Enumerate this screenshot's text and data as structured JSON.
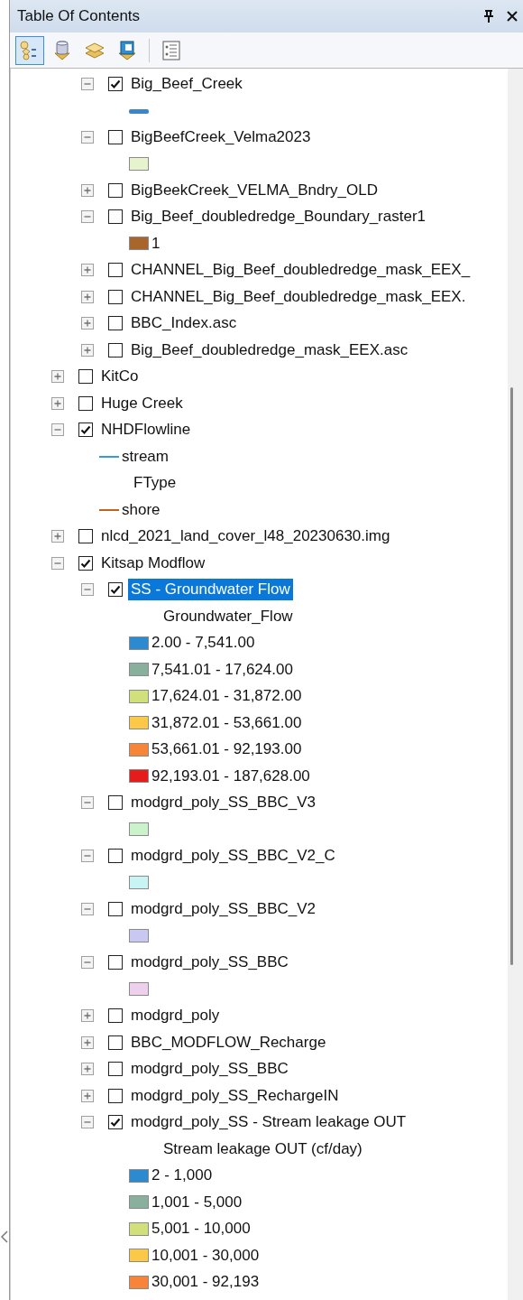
{
  "panel": {
    "title": "Table Of Contents"
  },
  "toolbar": [
    {
      "kind": "drawing-order",
      "selected": true
    },
    {
      "kind": "source",
      "selected": false
    },
    {
      "kind": "visibility",
      "selected": false
    },
    {
      "kind": "selection",
      "selected": false
    },
    {
      "kind": "options",
      "selected": false
    }
  ],
  "tree": [
    {
      "kind": "continuation",
      "children": [
        {
          "kind": "layer",
          "name": "Big_Beef_Creek",
          "checked": true,
          "expanded": true,
          "selected": false,
          "children": [
            {
              "kind": "legend-line",
              "color": "#3a86c8"
            }
          ]
        },
        {
          "kind": "layer",
          "name": "BigBeefCreek_Velma2023",
          "checked": false,
          "expanded": true,
          "selected": false,
          "children": [
            {
              "kind": "legend-fill",
              "color": "#e6f3cc"
            }
          ]
        },
        {
          "kind": "layer",
          "name": "BigBeekCreek_VELMA_Bndry_OLD",
          "checked": false,
          "expanded": false,
          "selected": false
        },
        {
          "kind": "layer",
          "name": "Big_Beef_doubledredge_Boundary_raster1",
          "checked": false,
          "expanded": true,
          "selected": false,
          "children": [
            {
              "kind": "legend-fill",
              "color": "#a8652c",
              "label": "1"
            }
          ]
        },
        {
          "kind": "layer",
          "name": "CHANNEL_Big_Beef_doubledredge_mask_EEX_",
          "checked": false,
          "expanded": false,
          "selected": false
        },
        {
          "kind": "layer",
          "name": "CHANNEL_Big_Beef_doubledredge_mask_EEX.",
          "checked": false,
          "expanded": false,
          "selected": false
        },
        {
          "kind": "layer",
          "name": "BBC_Index.asc",
          "checked": false,
          "expanded": false,
          "selected": false
        },
        {
          "kind": "layer",
          "name": "Big_Beef_doubledredge_mask_EEX.asc",
          "checked": false,
          "expanded": false,
          "selected": false
        }
      ]
    },
    {
      "kind": "layer",
      "name": "KitCo",
      "checked": false,
      "expanded": false,
      "selected": false
    },
    {
      "kind": "layer",
      "name": "Huge Creek",
      "checked": false,
      "expanded": false,
      "selected": false
    },
    {
      "kind": "layer",
      "name": "NHDFlowline",
      "checked": true,
      "expanded": true,
      "selected": false,
      "children": [
        {
          "kind": "legend-thin-line",
          "color": "#3a9ad8",
          "label": "stream"
        },
        {
          "kind": "heading",
          "label": "FType"
        },
        {
          "kind": "legend-thin-line",
          "color": "#c0641c",
          "label": "shore"
        }
      ]
    },
    {
      "kind": "layer",
      "name": "nlcd_2021_land_cover_l48_20230630.img",
      "checked": false,
      "expanded": false,
      "selected": false
    },
    {
      "kind": "layer",
      "name": "Kitsap Modflow",
      "checked": true,
      "expanded": true,
      "selected": false,
      "children": [
        {
          "kind": "layer",
          "name": "SS - Groundwater Flow",
          "checked": true,
          "expanded": true,
          "selected": true,
          "children": [
            {
              "kind": "heading",
              "label": "Groundwater_Flow"
            },
            {
              "kind": "legend-fill",
              "color": "#2c8ad0",
              "label": "2.00 - 7,541.00"
            },
            {
              "kind": "legend-fill",
              "color": "#88b09c",
              "label": "7,541.01 - 17,624.00"
            },
            {
              "kind": "legend-fill",
              "color": "#d2e07c",
              "label": "17,624.01 - 31,872.00"
            },
            {
              "kind": "legend-fill",
              "color": "#fcc848",
              "label": "31,872.01 - 53,661.00"
            },
            {
              "kind": "legend-fill",
              "color": "#f8843a",
              "label": "53,661.01 - 92,193.00"
            },
            {
              "kind": "legend-fill",
              "color": "#e51c1c",
              "label": "92,193.01 - 187,628.00"
            }
          ]
        },
        {
          "kind": "layer",
          "name": "modgrd_poly_SS_BBC_V3",
          "checked": false,
          "expanded": true,
          "selected": false,
          "children": [
            {
              "kind": "legend-fill",
              "color": "#ccf2cc"
            }
          ]
        },
        {
          "kind": "layer",
          "name": "modgrd_poly_SS_BBC_V2_C",
          "checked": false,
          "expanded": true,
          "selected": false,
          "children": [
            {
              "kind": "legend-fill",
              "color": "#c8f4f4"
            }
          ]
        },
        {
          "kind": "layer",
          "name": "modgrd_poly_SS_BBC_V2",
          "checked": false,
          "expanded": true,
          "selected": false,
          "children": [
            {
              "kind": "legend-fill",
              "color": "#c8c8f2"
            }
          ]
        },
        {
          "kind": "layer",
          "name": "modgrd_poly_SS_BBC",
          "checked": false,
          "expanded": true,
          "selected": false,
          "children": [
            {
              "kind": "legend-fill",
              "color": "#ecd0ec"
            }
          ]
        },
        {
          "kind": "layer",
          "name": "modgrd_poly",
          "checked": false,
          "expanded": false,
          "selected": false
        },
        {
          "kind": "layer",
          "name": "BBC_MODFLOW_Recharge",
          "checked": false,
          "expanded": false,
          "selected": false
        },
        {
          "kind": "layer",
          "name": "modgrd_poly_SS_BBC",
          "checked": false,
          "expanded": false,
          "selected": false
        },
        {
          "kind": "layer",
          "name": "modgrd_poly_SS_RechargeIN",
          "checked": false,
          "expanded": false,
          "selected": false
        },
        {
          "kind": "layer",
          "name": "modgrd_poly_SS - Stream leakage OUT",
          "checked": true,
          "expanded": true,
          "selected": false,
          "children": [
            {
              "kind": "heading",
              "label": "Stream leakage OUT (cf/day)"
            },
            {
              "kind": "legend-fill",
              "color": "#2c8ad0",
              "label": "2 - 1,000"
            },
            {
              "kind": "legend-fill",
              "color": "#88b09c",
              "label": "1,001 - 5,000"
            },
            {
              "kind": "legend-fill",
              "color": "#d2e07c",
              "label": "5,001 - 10,000"
            },
            {
              "kind": "legend-fill",
              "color": "#fcc848",
              "label": "10,001 - 30,000"
            },
            {
              "kind": "legend-fill",
              "color": "#f8843a",
              "label": "30,001 - 92,193"
            }
          ]
        }
      ]
    }
  ]
}
